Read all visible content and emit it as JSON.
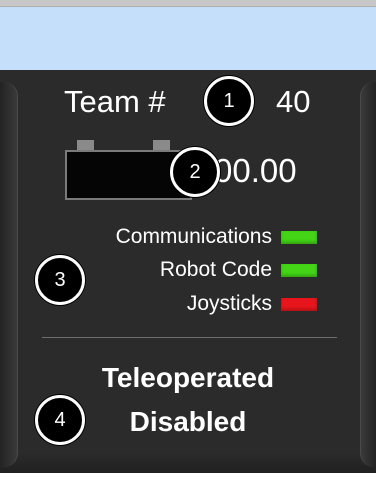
{
  "header": {
    "band_color": "#c5def9"
  },
  "team": {
    "label": "Team #",
    "number": "40"
  },
  "battery": {
    "icon": "battery-icon",
    "voltage": "00.00"
  },
  "status": [
    {
      "label": "Communications",
      "state": "ok",
      "color": "#44d616"
    },
    {
      "label": "Robot Code",
      "state": "ok",
      "color": "#44d616"
    },
    {
      "label": "Joysticks",
      "state": "error",
      "color": "#e8161c"
    }
  ],
  "mode": {
    "line1": "Teleoperated",
    "line2": "Disabled"
  },
  "callouts": [
    "1",
    "2",
    "3",
    "4"
  ]
}
